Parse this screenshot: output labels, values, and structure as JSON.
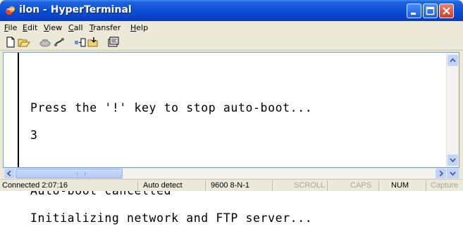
{
  "window": {
    "title": "ilon - HyperTerminal",
    "buttons": {
      "minimize": "minimize",
      "maximize": "maximize",
      "close": "close"
    }
  },
  "menu": {
    "items": [
      {
        "accel": "F",
        "rest": "ile"
      },
      {
        "accel": "E",
        "rest": "dit"
      },
      {
        "accel": "V",
        "rest": "iew"
      },
      {
        "accel": "C",
        "rest": "all"
      },
      {
        "accel": "T",
        "rest": "ransfer"
      },
      {
        "accel": "H",
        "rest": "elp"
      }
    ]
  },
  "toolbar": {
    "icons": [
      "new-icon",
      "open-icon",
      "connect-icon",
      "disconnect-icon",
      "send-icon",
      "receive-icon",
      "properties-icon"
    ]
  },
  "terminal": {
    "lines": [
      "Press the '!' key to stop auto-boot...",
      "3",
      "",
      "Auto-boot cancelled",
      "Initializing network and FTP server..."
    ]
  },
  "status": {
    "connected": "Connected 2:07:16",
    "detect": "Auto detect",
    "settings": "9600 8-N-1",
    "scroll": "SCROLL",
    "caps": "CAPS",
    "num": "NUM",
    "capture": "Capture"
  },
  "colors": {
    "titlebar": "#0a4fd6",
    "close_button": "#c64328",
    "terminal_bg": "#ffffff",
    "chrome": "#ece9d8"
  }
}
